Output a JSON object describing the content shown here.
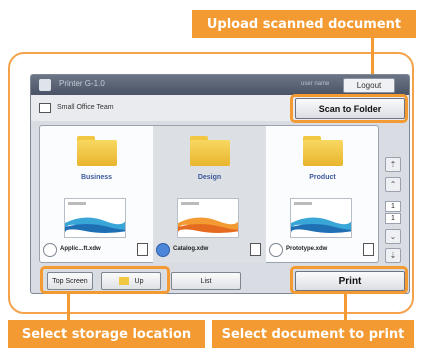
{
  "callouts": {
    "upload": "Upload scanned document",
    "storage": "Select storage location",
    "print": "Select document to print"
  },
  "titlebar": {
    "title": "Printer G-1.0",
    "user": "user name",
    "logout": "Logout"
  },
  "path": {
    "label": "Small Office Team"
  },
  "scan_button": "Scan to Folder",
  "folders": [
    {
      "name": "Business"
    },
    {
      "name": "Design"
    },
    {
      "name": "Product"
    }
  ],
  "documents": [
    {
      "name": "Applic...ft.xdw"
    },
    {
      "name": "Catalog.xdw"
    },
    {
      "name": "Prototype.xdw"
    }
  ],
  "pager": {
    "current": "1",
    "total": "1"
  },
  "bottom": {
    "top_screen": "Top Screen",
    "up": "Up",
    "list": "List",
    "print": "Print"
  },
  "colors": {
    "accent": "#f39a32",
    "folder": "#f2c842",
    "selected_radio": "#4c86d8"
  }
}
